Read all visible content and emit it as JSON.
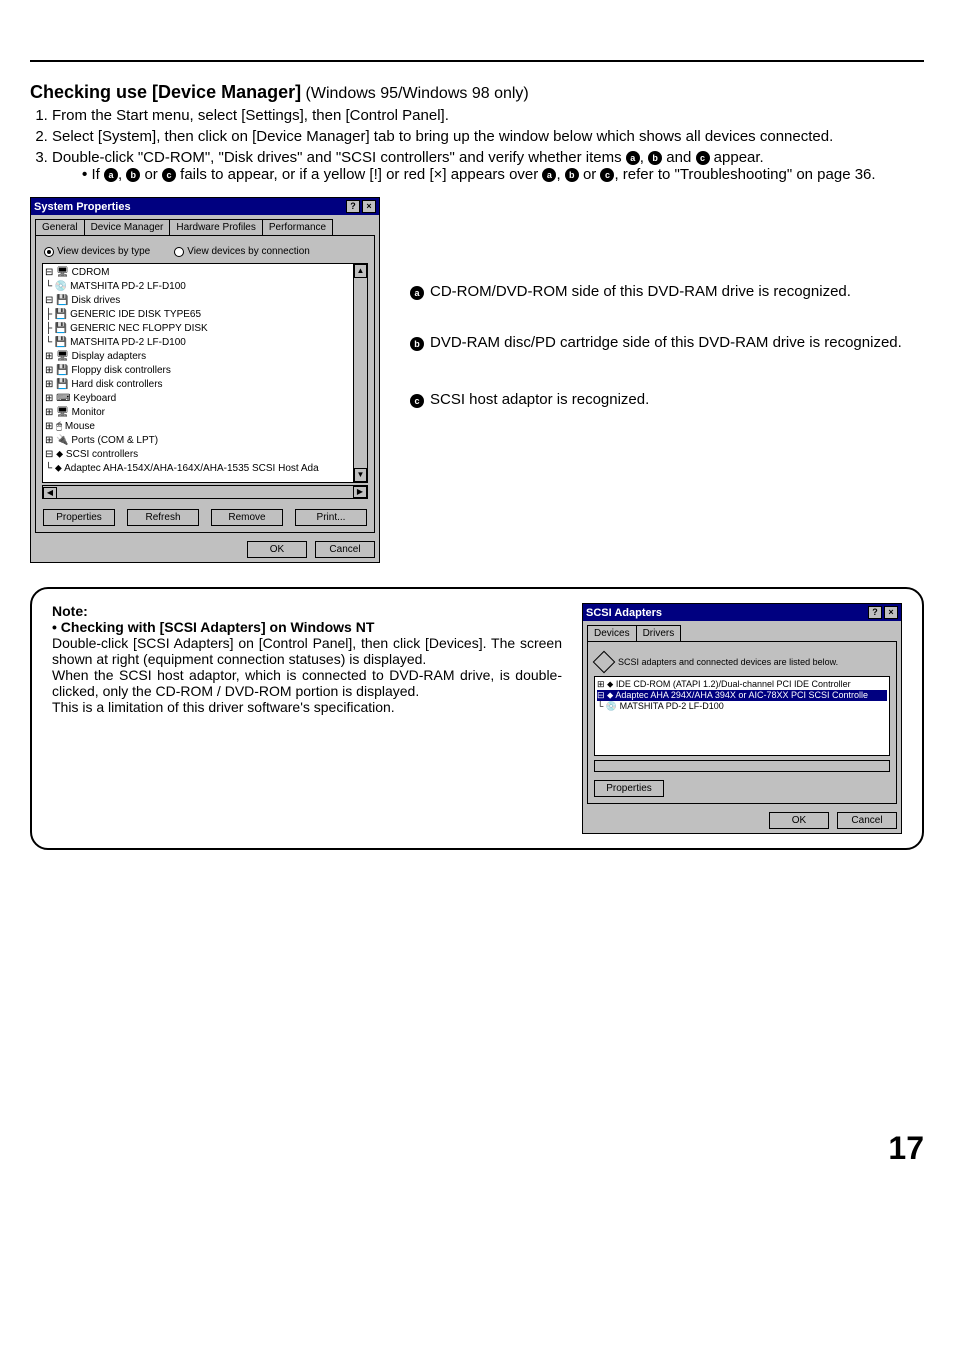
{
  "heading": {
    "title": "Checking use [Device Manager]",
    "subtitle": "(Windows 95/Windows 98 only)"
  },
  "steps": {
    "s1": "From the Start menu, select [Settings], then [Control Panel].",
    "s2": "Select [System], then click on [Device Manager] tab to bring up the window below which shows all devices connected.",
    "s3_pre": "Double-click \"CD-ROM\", \"Disk drives\" and \"SCSI controllers\" and verify whether items ",
    "s3_mid1": ", ",
    "s3_mid2": " and ",
    "s3_post": " appear.",
    "sub_pre": "If ",
    "sub_mid1": ", ",
    "sub_mid2": " or ",
    "sub_mid3": " fails to appear, or if a yellow [!] or red [×] appears over ",
    "sub_mid4": ", ",
    "sub_mid5": " or ",
    "sub_post": ", refer to \"Troubleshooting\" on page 36."
  },
  "badge": {
    "a": "a",
    "b": "b",
    "c": "c"
  },
  "window1": {
    "title": "System Properties",
    "help": "?",
    "close": "×",
    "tabs": {
      "general": "General",
      "device_mgr": "Device Manager",
      "hw_profiles": "Hardware Profiles",
      "performance": "Performance"
    },
    "radio1": "View devices by type",
    "radio2": "View devices by connection",
    "tree": {
      "l01": "⊟ 🖥 CDROM",
      "l02": "   └ 💿 MATSHITA PD-2 LF-D100",
      "l03": "⊟ 💾 Disk drives",
      "l04": "   ├ 💾 GENERIC IDE  DISK TYPE65",
      "l05": "   ├ 💾 GENERIC NEC  FLOPPY DISK",
      "l06": "   └ 💾 MATSHITA PD-2 LF-D100",
      "l07": "⊞ 🖥 Display adapters",
      "l08": "⊞ 💾 Floppy disk controllers",
      "l09": "⊞ 💾 Hard disk controllers",
      "l10": "⊞ ⌨ Keyboard",
      "l11": "⊞ 🖥 Monitor",
      "l12": "⊞ 🖱 Mouse",
      "l13": "⊞ 🔌 Ports (COM & LPT)",
      "l14": "⊟ ⬥ SCSI controllers",
      "l15": "   └ ⬥ Adaptec AHA-154X/AHA-164X/AHA-1535 SCSI Host Ada"
    },
    "buttons": {
      "properties": "Properties",
      "refresh": "Refresh",
      "remove": "Remove",
      "print": "Print..."
    },
    "ok": "OK",
    "cancel": "Cancel"
  },
  "annotations": {
    "a": "CD-ROM/DVD-ROM side of this DVD-RAM drive is recognized.",
    "b": "DVD-RAM disc/PD cartridge side of this DVD-RAM drive is recognized.",
    "c": "SCSI host adaptor is recognized."
  },
  "note": {
    "head": "Note:",
    "sub": "• Checking with [SCSI Adapters] on Windows NT",
    "p1": "Double-click [SCSI Adapters] on [Control Panel], then click [Devices]. The screen shown at right (equipment connection statuses) is displayed.",
    "p2": "When the SCSI host adaptor, which is connected to DVD-RAM drive, is double-clicked, only the CD-ROM / DVD-ROM portion is displayed.",
    "p3": "This is a limitation of this driver software's specification."
  },
  "window2": {
    "title": "SCSI Adapters",
    "help": "?",
    "close": "×",
    "tabs": {
      "devices": "Devices",
      "drivers": "Drivers"
    },
    "msg": "SCSI adapters and connected devices are listed below.",
    "list": {
      "l1": "⊞ ⬥ IDE CD-ROM (ATAPI 1.2)/Dual-channel PCI IDE Controller",
      "l2": "⊟ ⬥ Adaptec AHA 294X/AHA 394X or AIC-78XX PCI SCSI Controlle",
      "l3": "   └ 💿 MATSHITA PD-2 LF-D100"
    },
    "properties": "Properties",
    "ok": "OK",
    "cancel": "Cancel"
  },
  "page_number": "17"
}
